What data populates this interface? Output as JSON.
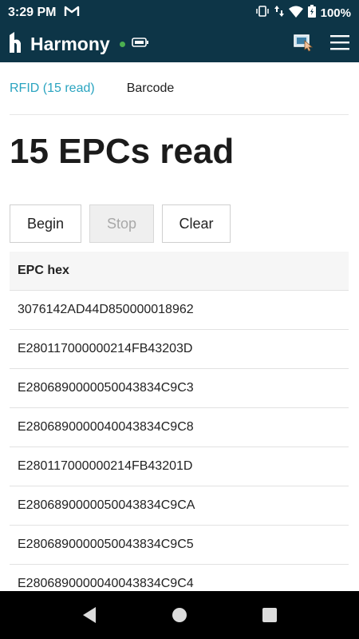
{
  "status_bar": {
    "time": "3:29 PM",
    "battery_percent": "100%",
    "icons": [
      "gmail-icon",
      "vibrate-icon",
      "data-arrows-icon",
      "wifi-icon",
      "battery-icon"
    ]
  },
  "app_bar": {
    "title": "Harmony",
    "connection_status_color": "#4caf50",
    "icons": [
      "harmony-logo-icon",
      "reader-battery-icon",
      "tap-scan-icon",
      "menu-icon"
    ]
  },
  "tabs": [
    {
      "label": "RFID (15 read)",
      "active": true
    },
    {
      "label": "Barcode",
      "active": false
    }
  ],
  "heading": "15 EPCs read",
  "buttons": {
    "begin": "Begin",
    "stop": "Stop",
    "clear": "Clear"
  },
  "table": {
    "header": "EPC hex",
    "rows": [
      "3076142AD44D850000018962",
      "E280117000000214FB43203D",
      "E2806890000050043834C9C3",
      "E2806890000040043834C9C8",
      "E280117000000214FB43201D",
      "E2806890000050043834C9CA",
      "E2806890000050043834C9C5",
      "E2806890000040043834C9C4"
    ]
  },
  "colors": {
    "app_bar": "#0d3547",
    "accent": "#2aa4c0"
  }
}
